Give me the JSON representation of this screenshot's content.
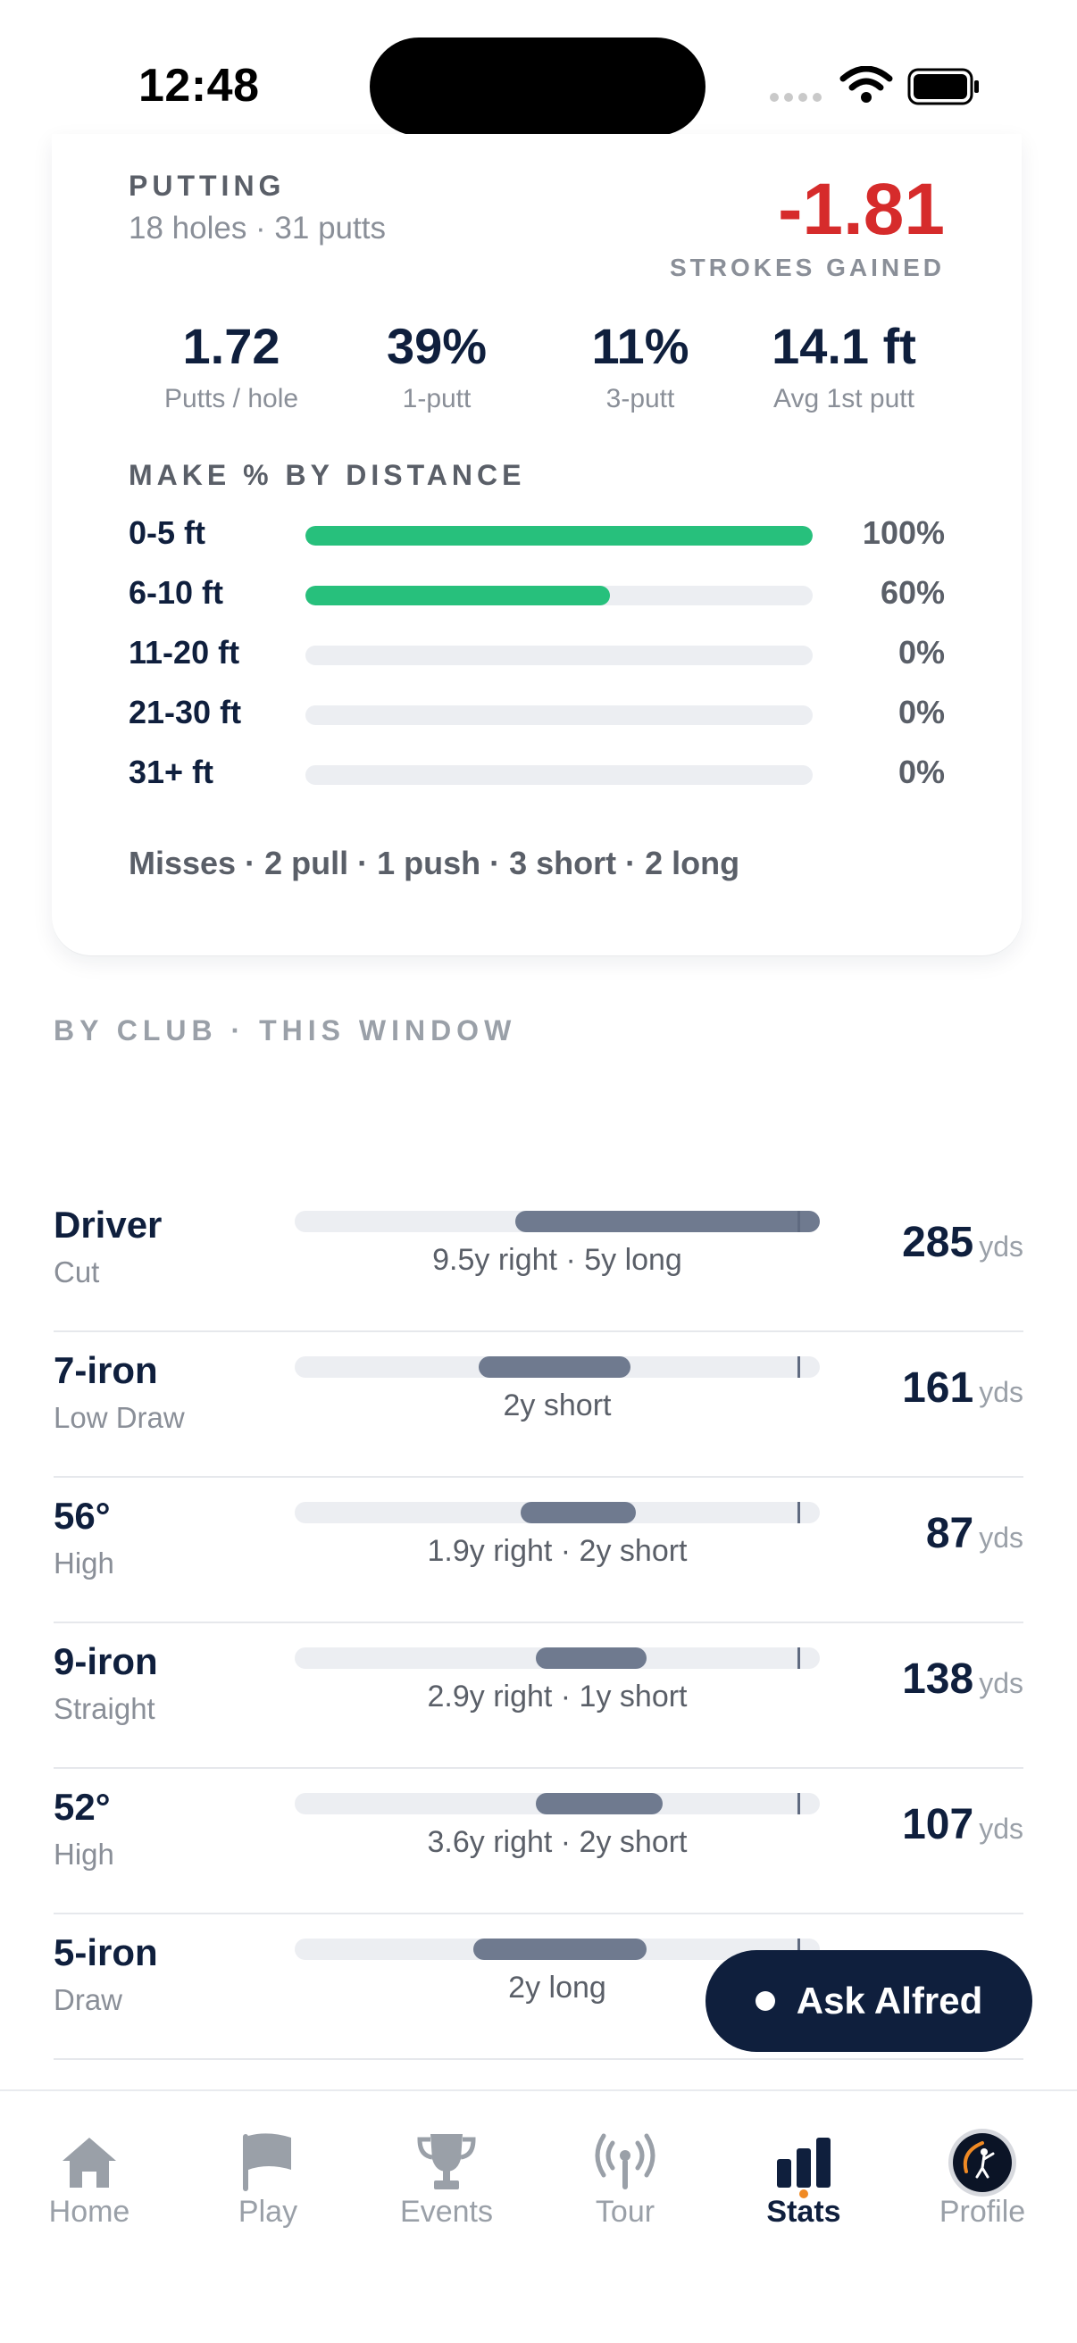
{
  "status_bar": {
    "time": "12:48"
  },
  "putting": {
    "title": "PUTTING",
    "subtitle": "18 holes · 31 putts",
    "strokes_gained_value": "-1.81",
    "strokes_gained_label": "STROKES GAINED",
    "stats": [
      {
        "value": "1.72",
        "label": "Putts / hole"
      },
      {
        "value": "39%",
        "label": "1-putt"
      },
      {
        "value": "11%",
        "label": "3-putt"
      },
      {
        "value": "14.1 ft",
        "label": "Avg 1st putt"
      }
    ],
    "make_title": "MAKE % BY DISTANCE",
    "distances": [
      {
        "label": "0-5 ft",
        "percent_text": "100%",
        "value": 100
      },
      {
        "label": "6-10 ft",
        "percent_text": "60%",
        "value": 60
      },
      {
        "label": "11-20 ft",
        "percent_text": "0%",
        "value": 0
      },
      {
        "label": "21-30 ft",
        "percent_text": "0%",
        "value": 0
      },
      {
        "label": "31+ ft",
        "percent_text": "0%",
        "value": 0
      }
    ],
    "misses": "Misses · 2 pull · 1 push · 3 short · 2 long"
  },
  "by_club": {
    "title": "BY CLUB · THIS WINDOW",
    "unit": "yds",
    "clubs": [
      {
        "name": "Driver",
        "shape": "Cut",
        "desc": "9.5y right · 5y long",
        "distance": "285",
        "dispersion": [
          0.42,
          1.0
        ]
      },
      {
        "name": "7-iron",
        "shape": "Low Draw",
        "desc": "2y short",
        "distance": "161",
        "dispersion": [
          0.35,
          0.64
        ]
      },
      {
        "name": "56°",
        "shape": "High",
        "desc": "1.9y right · 2y short",
        "distance": "87",
        "dispersion": [
          0.43,
          0.65
        ]
      },
      {
        "name": "9-iron",
        "shape": "Straight",
        "desc": "2.9y right · 1y short",
        "distance": "138",
        "dispersion": [
          0.46,
          0.67
        ]
      },
      {
        "name": "52°",
        "shape": "High",
        "desc": "3.6y right · 2y short",
        "distance": "107",
        "dispersion": [
          0.46,
          0.7
        ]
      },
      {
        "name": "5-iron",
        "shape": "Draw",
        "desc": "2y long",
        "distance": "",
        "dispersion": [
          0.34,
          0.67
        ]
      }
    ]
  },
  "ask_button": {
    "label": "Ask Alfred"
  },
  "tabs": [
    {
      "label": "Home",
      "icon": "home-icon"
    },
    {
      "label": "Play",
      "icon": "flag-icon"
    },
    {
      "label": "Events",
      "icon": "trophy-icon"
    },
    {
      "label": "Tour",
      "icon": "broadcast-icon"
    },
    {
      "label": "Stats",
      "icon": "bar-chart-icon",
      "active": true
    },
    {
      "label": "Profile",
      "icon": "avatar"
    }
  ],
  "colors": {
    "navy": "#0f1f3d",
    "red": "#d62b2b",
    "green": "#27c07c",
    "bar_gray": "#6f7a8f"
  }
}
